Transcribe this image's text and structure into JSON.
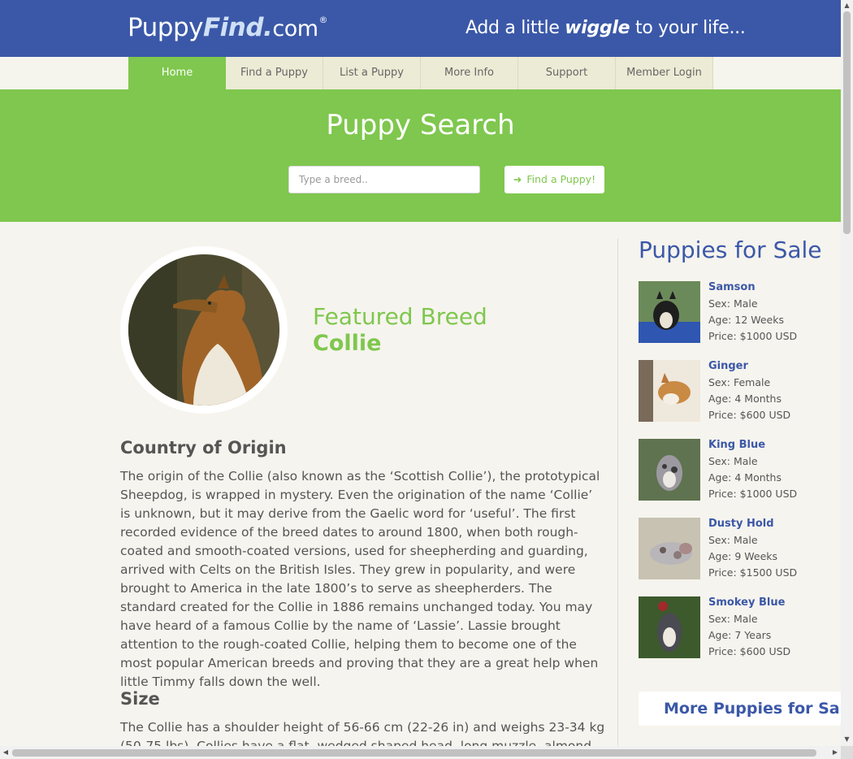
{
  "header": {
    "logo": {
      "part1": "Puppy",
      "part2": "Find.",
      "part3": "com",
      "reg": "®"
    },
    "tagline": {
      "before": "Add a little ",
      "emph": "wiggle",
      "after": " to your life..."
    }
  },
  "nav": {
    "items": [
      {
        "label": "Home"
      },
      {
        "label": "Find a Puppy"
      },
      {
        "label": "List a Puppy"
      },
      {
        "label": "More Info"
      },
      {
        "label": "Support"
      },
      {
        "label": "Member Login"
      }
    ]
  },
  "hero": {
    "title": "Puppy Search",
    "search_placeholder": "Type a breed..",
    "button_label": "Find a Puppy!",
    "button_icon": "arrow-right-icon"
  },
  "featured": {
    "label": "Featured Breed",
    "breed": "Collie"
  },
  "sections": [
    {
      "heading": "Country of Origin",
      "text": "The origin of the Collie (also known as the ‘Scottish Collie’), the prototypical Sheepdog, is wrapped in mystery. Even the origination of the name ‘Collie’ is unknown, but it may derive from the Gaelic word for ‘useful’. The first recorded evidence of the breed dates to around 1800, when both rough-coated and smooth-coated versions, used for sheepherding and guarding, arrived with Celts on the British Isles. They grew in popularity, and were brought to America in the late 1800’s to serve as sheepherders. The standard created for the Collie in 1886 remains unchanged today. You may have heard of a famous Collie by the name of ‘Lassie’. Lassie brought attention to the rough-coated Collie, helping them to become one of the most popular American breeds and proving that they are a great help when little Timmy falls down the well."
    },
    {
      "heading": "Size",
      "text": "The Collie has a shoulder height of 56-66 cm (22-26 in) and weighs 23-34 kg (50-75 lbs). Collies have a flat, wedged shaped head, long muzzle, almond shaped eyes"
    }
  ],
  "sidebar": {
    "title": "Puppies for Sale",
    "puppies": [
      {
        "name": "Samson",
        "sex": "Sex: Male",
        "age": "Age: 12 Weeks",
        "price": "Price: $1000 USD"
      },
      {
        "name": "Ginger",
        "sex": "Sex: Female",
        "age": "Age: 4 Months",
        "price": "Price: $600 USD"
      },
      {
        "name": "King Blue",
        "sex": "Sex: Male",
        "age": "Age: 4 Months",
        "price": "Price: $1000 USD"
      },
      {
        "name": "Dusty Hold",
        "sex": "Sex: Male",
        "age": "Age: 9 Weeks",
        "price": "Price: $1500 USD"
      },
      {
        "name": "Smokey Blue",
        "sex": "Sex: Male",
        "age": "Age: 7 Years",
        "price": "Price: $600 USD"
      }
    ],
    "more_label": "More Puppies for Sale"
  },
  "colors": {
    "header_blue": "#3b58a8",
    "accent_green": "#7fc74e",
    "page_bg": "#f6f4ee",
    "nav_bg": "#ecebd5",
    "body_text": "#555555"
  }
}
